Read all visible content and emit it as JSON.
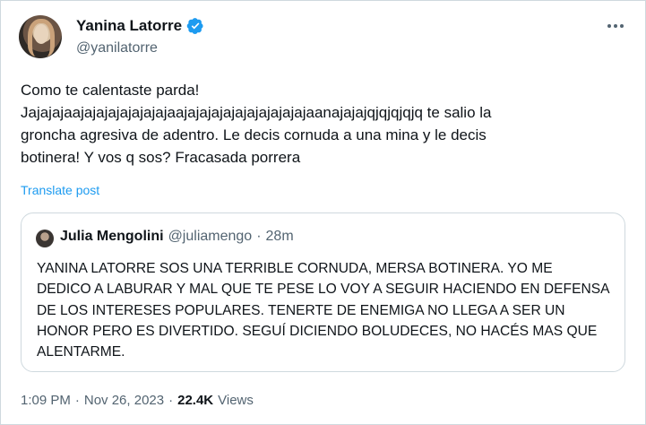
{
  "author": {
    "display_name": "Yanina Latorre",
    "handle": "@yanilatorre",
    "verified_color": "#1d9bf0"
  },
  "tweet": {
    "text": "Como te calentaste parda!\nJajajajaajajajajajajajajaajajajajajajajajajajajaanajajajqjqjqjqjq te salio la\ngroncha agresiva de adentro. Le decis cornuda a una mina y le decis\nbotinera! Y vos q sos? Fracasada porrera",
    "translate_label": "Translate post"
  },
  "quoted": {
    "display_name": "Julia Mengolini",
    "handle": "@juliamengo",
    "separator": "·",
    "time": "28m",
    "text": "YANINA LATORRE SOS UNA TERRIBLE CORNUDA, MERSA BOTINERA. YO ME DEDICO A LABURAR Y MAL QUE TE PESE LO VOY A SEGUIR HACIENDO EN DEFENSA DE LOS INTERESES POPULARES. TENERTE DE ENEMIGA NO LLEGA A SER UN HONOR PERO ES DIVERTIDO. SEGUÍ DICIENDO BOLUDECES, NO HACÉS MAS QUE ALENTARME."
  },
  "meta": {
    "time": "1:09 PM",
    "sep1": "·",
    "date": "Nov 26, 2023",
    "sep2": "·",
    "views_count": "22.4K",
    "views_label": "Views"
  }
}
